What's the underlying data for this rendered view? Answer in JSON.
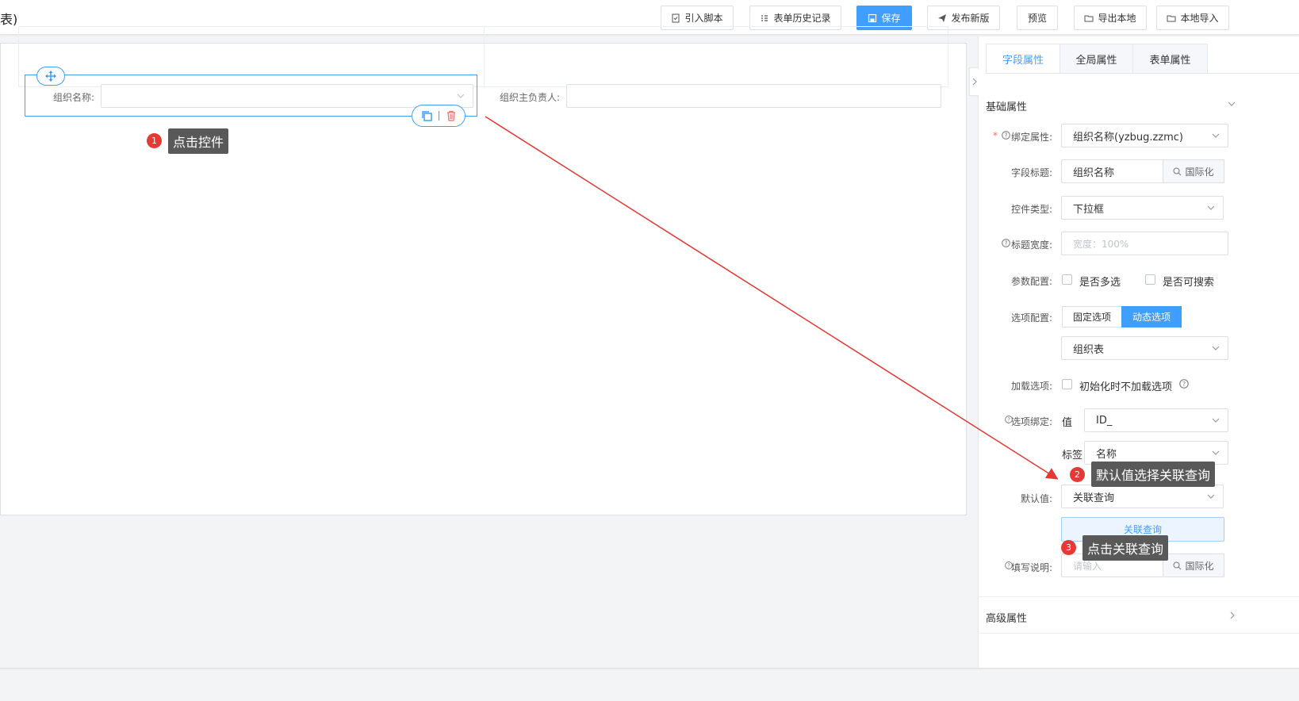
{
  "header": {
    "title_fragment": "表)",
    "buttons": {
      "import_script": "引入脚本",
      "history": "表单历史记录",
      "save": "保存",
      "publish": "发布新版",
      "preview": "预览",
      "export_local": "导出本地",
      "import_local": "本地导入"
    }
  },
  "canvas": {
    "field1_label": "组织名称:",
    "field2_label": "组织主负责人:"
  },
  "annotations": {
    "step1": {
      "num": "1",
      "text": "点击控件"
    },
    "step2": {
      "num": "2",
      "text": "默认值选择关联查询"
    },
    "step3": {
      "num": "3",
      "text": "点击关联查询"
    }
  },
  "panel": {
    "tabs": [
      "字段属性",
      "全局属性",
      "表单属性"
    ],
    "basic_section": "基础属性",
    "advanced_section": "高级属性",
    "bind_attr": {
      "label": "绑定属性:",
      "value": "组织名称(yzbug.zzmc)"
    },
    "field_title": {
      "label": "字段标题:",
      "value": "组织名称",
      "addon": "国际化"
    },
    "control_type": {
      "label": "控件类型:",
      "value": "下拉框"
    },
    "title_width": {
      "label": "标题宽度:",
      "placeholder": "宽度：100%"
    },
    "param_config": {
      "label": "参数配置:",
      "opt1": "是否多选",
      "opt2": "是否可搜索"
    },
    "option_config": {
      "label": "选项配置:",
      "fixed": "固定选项",
      "dynamic": "动态选项",
      "source": "组织表"
    },
    "load_option": {
      "label": "加载选项:",
      "opt": "初始化时不加载选项"
    },
    "option_bind": {
      "label": "选项绑定:",
      "value_label": "值",
      "value": "ID_",
      "tag_label": "标签",
      "tag": "名称"
    },
    "default_value": {
      "label": "默认值:",
      "value": "关联查询",
      "button": "关联查询"
    },
    "fill_desc": {
      "label": "填写说明:",
      "placeholder": "请输入",
      "addon": "国际化"
    }
  },
  "colors": {
    "primary": "#409eff",
    "badge": "#e53935",
    "arrow": "#e53935"
  }
}
